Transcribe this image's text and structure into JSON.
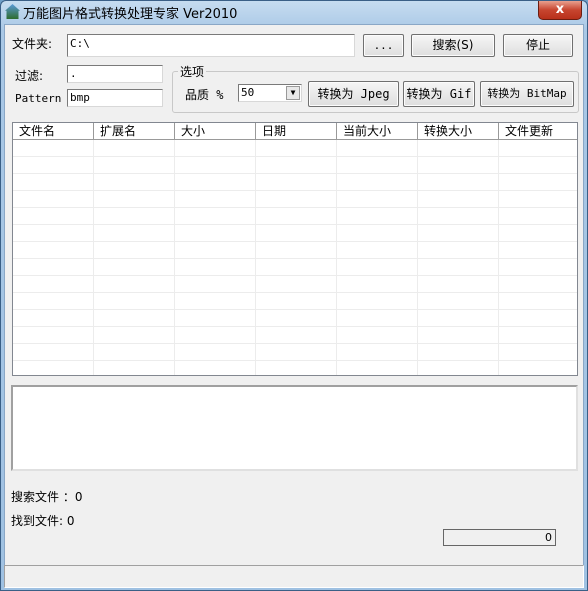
{
  "window": {
    "title": "万能图片格式转换处理专家 Ver2010",
    "close_label": "x"
  },
  "folder": {
    "label": "文件夹:",
    "value": "C:\\",
    "browse_label": "...",
    "search_label": "搜索(S)",
    "stop_label": "停止"
  },
  "filter": {
    "label": "过滤:",
    "value": ".",
    "pattern_label": "Pattern",
    "pattern_value": "bmp"
  },
  "options": {
    "group_label": "选项",
    "quality_label": "品质 %",
    "quality_value": "50",
    "to_jpeg": "转换为 Jpeg",
    "to_gif": "转换为 Gif",
    "to_bitmap": "转换为 BitMap"
  },
  "list": {
    "columns": [
      "文件名",
      "扩展名",
      "大小",
      "日期",
      "当前大小",
      "转换大小",
      "文件更新"
    ]
  },
  "stats": {
    "search_files_label": "搜索文件 ：",
    "search_files_value": "0",
    "found_files_label": "找到文件:",
    "found_files_value": "0",
    "progress_value": "0"
  }
}
